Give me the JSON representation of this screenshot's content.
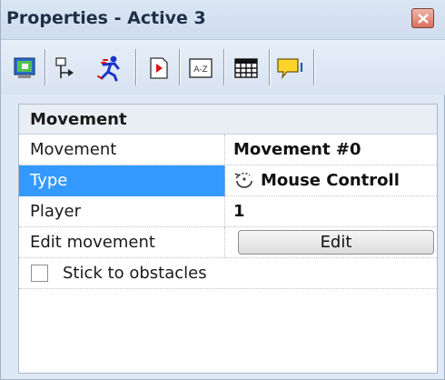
{
  "window": {
    "title": "Properties - Active 3"
  },
  "toolbar": {
    "buttons": [
      {
        "icon": "display-icon"
      },
      {
        "icon": "movement-path-icon"
      },
      {
        "icon": "running-man-icon"
      },
      {
        "icon": "events-icon"
      },
      {
        "icon": "about-az-icon"
      },
      {
        "icon": "grid-icon"
      },
      {
        "icon": "comment-icon"
      }
    ]
  },
  "panel": {
    "section_title": "Movement",
    "rows": [
      {
        "label": "Movement",
        "value": "Movement #0"
      },
      {
        "label": "Type",
        "value": "Mouse Controll"
      },
      {
        "label": "Player",
        "value": "1"
      },
      {
        "label": "Edit movement",
        "button_label": "Edit"
      }
    ],
    "checkbox": {
      "label": "Stick to obstacles",
      "checked": false
    }
  },
  "colors": {
    "selected_row": "#3399ff",
    "titlebar": "#d4e0f0",
    "close_button": "#d9705c"
  }
}
